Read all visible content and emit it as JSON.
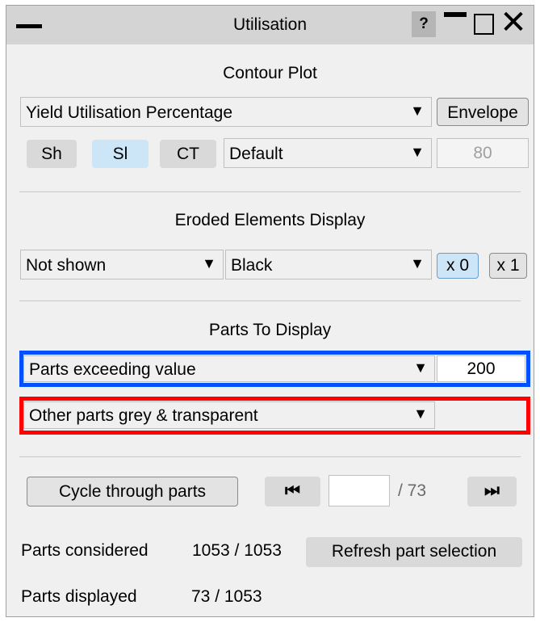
{
  "window": {
    "title": "Utilisation",
    "help_label": "?"
  },
  "contour": {
    "heading": "Contour Plot",
    "mode_value": "Yield Utilisation Percentage",
    "envelope_label": "Envelope",
    "sh_label": "Sh",
    "sl_label": "Sl",
    "ct_label": "CT",
    "scale_value": "Default",
    "scale_number": "80"
  },
  "eroded": {
    "heading": "Eroded Elements Display",
    "show_value": "Not shown",
    "colour_value": "Black",
    "x0_label": "x 0",
    "x1_label": "x 1"
  },
  "parts": {
    "heading": "Parts To Display",
    "filter_value": "Parts exceeding value",
    "threshold": "200",
    "other_value": "Other parts grey & transparent"
  },
  "cycle": {
    "button_label": "Cycle through parts",
    "current_index": "",
    "total_label": "/ 73"
  },
  "stats": {
    "considered_label": "Parts considered",
    "considered_value": "1053 / 1053",
    "refresh_label": "Refresh part selection",
    "displayed_label": "Parts displayed",
    "displayed_value": "73 / 1053"
  },
  "colors": {
    "highlight_blue": "#0050ff",
    "highlight_red": "#ff0000",
    "active_button": "#cde6f7"
  }
}
